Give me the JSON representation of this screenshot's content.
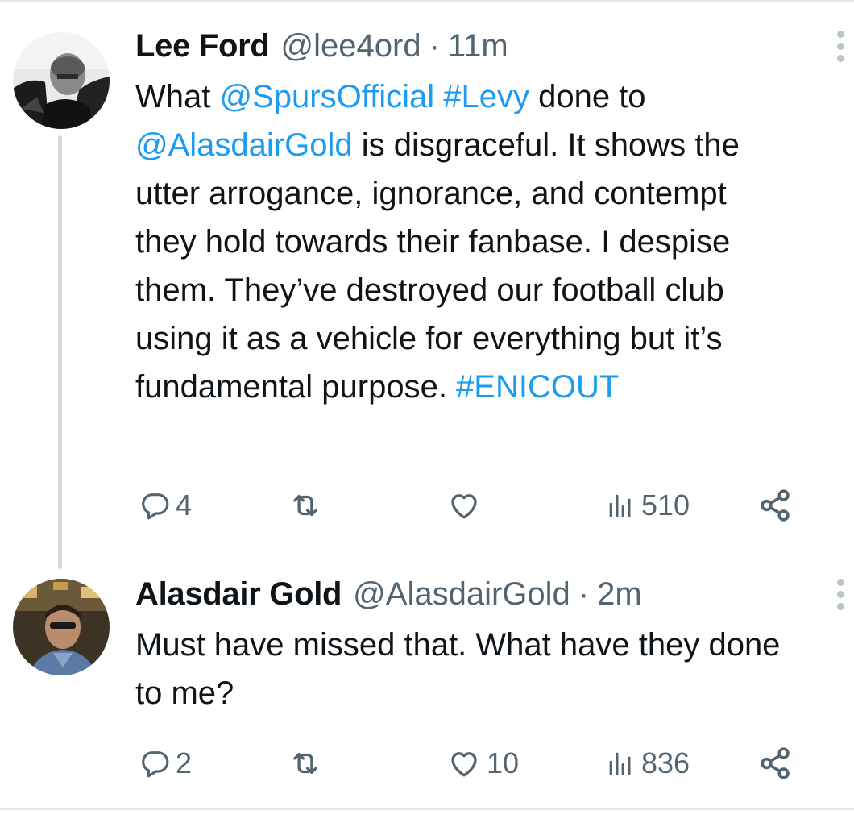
{
  "tweets": [
    {
      "name": "Lee Ford",
      "handle": "@lee4ord",
      "sep": "·",
      "time": "11m",
      "text": {
        "t1": "What ",
        "m1": "@SpursOfficial",
        "s1": " ",
        "h1": "#Levy",
        "t2": " done to ",
        "m2": "@AlasdairGold",
        "t3": " is disgraceful. It shows the utter arrogance, ignorance, and contempt they hold towards their fanbase. I despise them. They’ve destroyed our football club using it as a vehicle for everything but it’s fundamental purpose. ",
        "h2": "#ENICOUT"
      },
      "stats": {
        "replies": "4",
        "retweets": "",
        "likes": "",
        "views": "510"
      }
    },
    {
      "name": "Alasdair Gold",
      "handle": "@AlasdairGold",
      "sep": "·",
      "time": "2m",
      "text": {
        "t1": "Must have missed that. What have they done to me?"
      },
      "stats": {
        "replies": "2",
        "retweets": "",
        "likes": "10",
        "views": "836"
      }
    }
  ],
  "icons": {
    "reply": "reply-icon",
    "retweet": "retweet-icon",
    "like": "heart-icon",
    "views": "views-icon",
    "share": "share-icon",
    "more": "more-vertical-icon"
  },
  "colors": {
    "link": "#1d9bf0",
    "secondary": "#536471",
    "thread_line": "#cfd9de",
    "text": "#0f1419"
  }
}
